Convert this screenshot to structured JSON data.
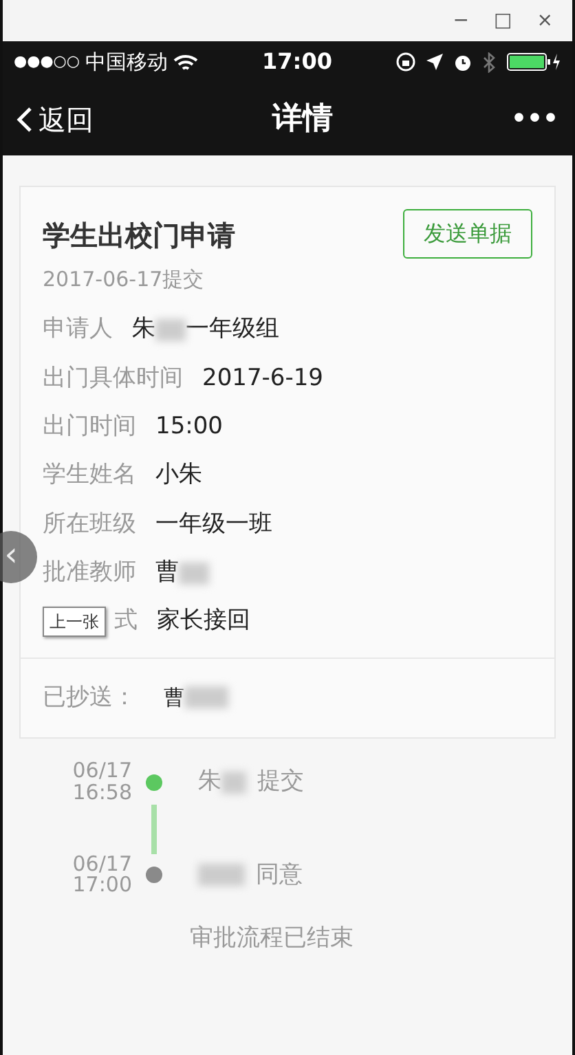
{
  "window": {
    "controls": [
      "−",
      "□",
      "×"
    ]
  },
  "status_bar": {
    "signal": "●●●○○",
    "carrier": "中国移动",
    "time": "17:00"
  },
  "nav": {
    "back": "返回",
    "title": "详情",
    "more": "•••"
  },
  "card": {
    "title": "学生出校门申请",
    "action": "发送单据",
    "submitted": "2017-06-17提交",
    "fields": [
      {
        "label": "申请人",
        "value": "朱",
        "redacted": true,
        "value_after": "一年级组"
      },
      {
        "label": "出门具体时间",
        "value": "2017-6-19",
        "redacted": false
      },
      {
        "label": "出门时间",
        "value": "15:00",
        "redacted": false
      },
      {
        "label": "学生姓名",
        "value": "小朱",
        "redacted": false
      },
      {
        "label": "所在班级",
        "value": "一年级一班",
        "redacted": false
      },
      {
        "label": "批准教师",
        "value": "曹",
        "redacted": true
      },
      {
        "label": "式",
        "value": "家长接回",
        "redacted": false
      }
    ],
    "cc": {
      "label": "已抄送：",
      "value": "曹",
      "redacted": true
    }
  },
  "overlay": {
    "prev_arrow": "‹",
    "tooltip": "上一张"
  },
  "timeline": [
    {
      "date": "06/17",
      "time": "16:58",
      "name": "朱",
      "redacted": true,
      "action": "提交",
      "color": "#5cc860"
    },
    {
      "date": "06/17",
      "time": "17:00",
      "redacted": true,
      "action": "同意",
      "color": "#8a8a8a"
    }
  ],
  "footer": "审批流程已结束"
}
